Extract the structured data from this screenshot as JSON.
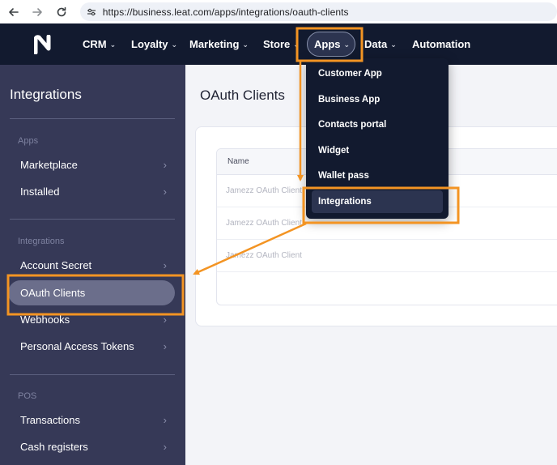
{
  "browser": {
    "url": "https://business.leat.com/apps/integrations/oauth-clients",
    "back_icon": "arrow-left-icon",
    "forward_icon": "arrow-right-icon",
    "reload_icon": "reload-icon",
    "site_info_icon": "tune-icon"
  },
  "topnav": {
    "logo_icon": "leat-logo",
    "items": [
      {
        "label": "CRM",
        "dropdown": true
      },
      {
        "label": "Loyalty",
        "dropdown": true
      },
      {
        "label": "Marketing",
        "dropdown": true
      },
      {
        "label": "Store",
        "dropdown": true
      },
      {
        "label": "Apps",
        "dropdown": true,
        "active": true
      },
      {
        "label": "Data",
        "dropdown": true
      },
      {
        "label": "Automation",
        "dropdown": false
      }
    ]
  },
  "apps_menu": {
    "items": [
      {
        "label": "Customer App"
      },
      {
        "label": "Business App"
      },
      {
        "label": "Contacts portal"
      },
      {
        "label": "Widget"
      },
      {
        "label": "Wallet pass"
      },
      {
        "label": "Integrations",
        "highlighted": true
      }
    ]
  },
  "sidebar": {
    "title": "Integrations",
    "sections": [
      {
        "heading": "Apps",
        "items": [
          {
            "label": "Marketplace"
          },
          {
            "label": "Installed"
          }
        ]
      },
      {
        "heading": "Integrations",
        "items": [
          {
            "label": "Account Secret"
          },
          {
            "label": "OAuth Clients",
            "active": true
          },
          {
            "label": "Webhooks"
          },
          {
            "label": "Personal Access Tokens"
          }
        ]
      },
      {
        "heading": "POS",
        "items": [
          {
            "label": "Transactions"
          },
          {
            "label": "Cash registers"
          }
        ]
      }
    ]
  },
  "main": {
    "title": "OAuth Clients",
    "table": {
      "columns": [
        "Name"
      ],
      "rows": [
        "Jamezz OAuth Client",
        "Jamezz OAuth Client",
        "Jamezz OAuth Client"
      ]
    }
  },
  "colors": {
    "nav_bg": "#121a2f",
    "sidebar_bg": "#363957",
    "annotation": "#f39423"
  }
}
